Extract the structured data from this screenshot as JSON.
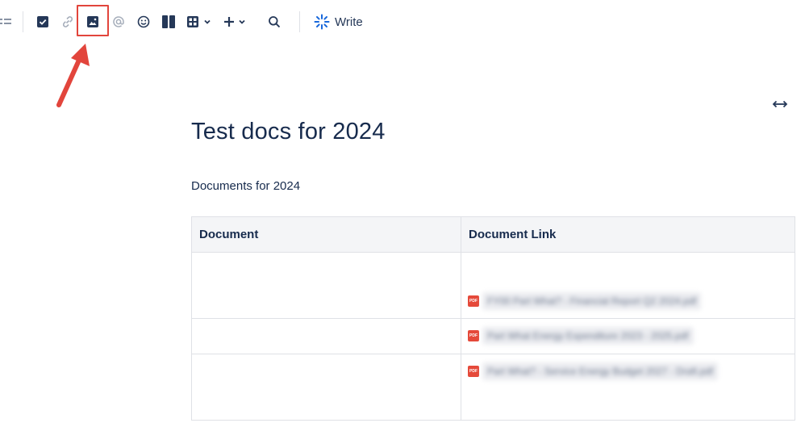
{
  "toolbar": {
    "items": [
      {
        "name": "list-icon"
      },
      {
        "name": "checkbox-icon"
      },
      {
        "name": "link-icon"
      },
      {
        "name": "image-icon"
      },
      {
        "name": "mention-icon"
      },
      {
        "name": "emoji-icon"
      },
      {
        "name": "layout-icon"
      },
      {
        "name": "table-icon"
      },
      {
        "name": "insert-plus-icon"
      },
      {
        "name": "search-icon"
      }
    ],
    "write_label": "Write",
    "accent_color": "#1868db",
    "highlight_color": "#e2453c"
  },
  "page": {
    "title": "Test docs for 2024",
    "subtitle": "Documents for 2024"
  },
  "table": {
    "headers": [
      "Document",
      "Document Link"
    ],
    "rows": [
      {
        "document": "",
        "link": "FY00 Part What? - Financial Report Q2 2024.pdf"
      },
      {
        "document": "",
        "link": "Part What Energy Expenditure 2023 - 2025.pdf"
      },
      {
        "document": "",
        "link": "Part What? - Service Energy Budget 2027 - Draft.pdf"
      }
    ]
  },
  "file_icon_label": "PDF"
}
